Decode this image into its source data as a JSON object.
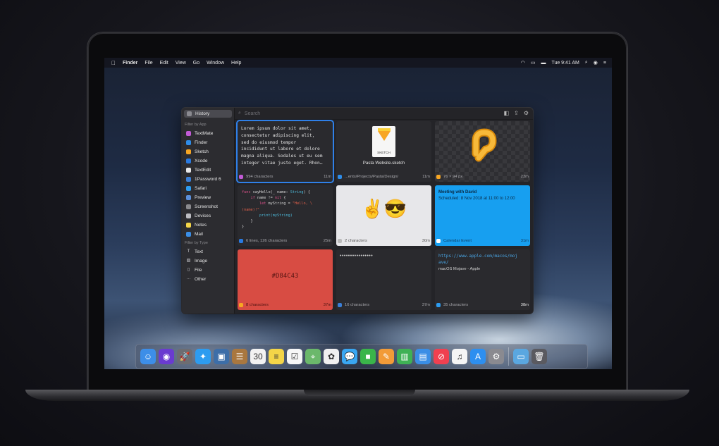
{
  "menubar": {
    "app": "Finder",
    "menus": [
      "File",
      "Edit",
      "View",
      "Go",
      "Window",
      "Help"
    ],
    "clock": "Tue 9:41 AM"
  },
  "sidebar": {
    "history": "History",
    "filter_by_app_label": "Filter by App",
    "apps": [
      {
        "label": "TextMate",
        "icon": "textmate-icon",
        "color": "#c25bd6"
      },
      {
        "label": "Finder",
        "icon": "finder-icon",
        "color": "#2e8ce8"
      },
      {
        "label": "Sketch",
        "icon": "sketch-icon",
        "color": "#f7a623"
      },
      {
        "label": "Xcode",
        "icon": "xcode-icon",
        "color": "#2a7ae0"
      },
      {
        "label": "TextEdit",
        "icon": "textedit-icon",
        "color": "#e8e8e8"
      },
      {
        "label": "1Password 6",
        "icon": "onepassword-icon",
        "color": "#3b7fd6"
      },
      {
        "label": "Safari",
        "icon": "safari-icon",
        "color": "#2d9cf0"
      },
      {
        "label": "Preview",
        "icon": "preview-icon",
        "color": "#5b8fd9"
      },
      {
        "label": "Screenshot",
        "icon": "screenshot-icon",
        "color": "#8a8a8e"
      },
      {
        "label": "Devices",
        "icon": "devices-icon",
        "color": "#bdbdc2"
      },
      {
        "label": "Notes",
        "icon": "notes-icon",
        "color": "#f4d548"
      },
      {
        "label": "Mail",
        "icon": "mail-icon",
        "color": "#3a8ee6"
      }
    ],
    "filter_by_type_label": "Filter by Type",
    "types": [
      {
        "label": "Text",
        "icon": "text-type-icon"
      },
      {
        "label": "Image",
        "icon": "image-type-icon"
      },
      {
        "label": "File",
        "icon": "file-type-icon"
      },
      {
        "label": "Other",
        "icon": "other-type-icon"
      }
    ]
  },
  "search": {
    "placeholder": "Search"
  },
  "cards": {
    "lorem": {
      "text": "Lorem ipsum dolor sit amet,\nconsectetur adipiscing elit,\nsed do eiusmod tempor\nincididunt ut labore et dolore\nmagna aliqua. Sodales ut eu sem\ninteger vitae justo eget. Rhon…",
      "meta": "994 characters",
      "time": "11m"
    },
    "sketch": {
      "file_label": "SKETCH",
      "filename": "Pasta Website.sketch",
      "meta": "...ents/Projects/Pasta/Design/",
      "time": "11m"
    },
    "image": {
      "meta": "76 × 94 px",
      "time": "23m"
    },
    "code": {
      "l1a": "func",
      "l1b": " sayHello(_ name: ",
      "l1c": "String",
      "l1d": ") {",
      "l2a": "    if",
      "l2b": " name != ",
      "l2c": "nil",
      "l2d": " {",
      "l3a": "        let",
      "l3b": " myString = ",
      "l3c": "\"Hello, \\",
      "l4a": "(name)!\"",
      "l5": "        print(myString)",
      "l6": "    }",
      "l7": "}",
      "meta": "6 lines, 126 characters",
      "time": "25m"
    },
    "emoji": {
      "text": "✌️😎",
      "meta": "2 characters",
      "time": "30m"
    },
    "calendar": {
      "title": "Meeting with David",
      "scheduled": "Scheduled: 8 Nov 2018 at 11:00 to 12:00",
      "meta": "Calendar Event",
      "time": "31m"
    },
    "color": {
      "value": "#D84C43",
      "meta": "8 characters",
      "time": "37m"
    },
    "password": {
      "dots": "••••••••••••••••",
      "meta": "16 characters",
      "time": "37m"
    },
    "link": {
      "url": "https://www.apple.com/macos/moj\nave/",
      "title": "macOS Mojave - Apple",
      "meta": "35 characters",
      "time": "38m"
    }
  },
  "dock": {
    "apps": [
      {
        "name": "finder-dock-icon",
        "glyph": "☺",
        "color": "#3d8ee8"
      },
      {
        "name": "siri-dock-icon",
        "glyph": "◉",
        "color": "#6a3bd0"
      },
      {
        "name": "launchpad-dock-icon",
        "glyph": "🚀",
        "color": "#6d6d72"
      },
      {
        "name": "safari-dock-icon",
        "glyph": "✦",
        "color": "#2d9cf0"
      },
      {
        "name": "photo-booth-dock-icon",
        "glyph": "▣",
        "color": "#3d6ea8"
      },
      {
        "name": "contacts-dock-icon",
        "glyph": "☰",
        "color": "#a9773f"
      },
      {
        "name": "calendar-dock-icon",
        "glyph": "30",
        "color": "#f2f2f2"
      },
      {
        "name": "notes-dock-icon",
        "glyph": "≡",
        "color": "#f4d548"
      },
      {
        "name": "reminders-dock-icon",
        "glyph": "☑",
        "color": "#f7f7f7"
      },
      {
        "name": "maps-dock-icon",
        "glyph": "⌖",
        "color": "#6bb86b"
      },
      {
        "name": "photos-dock-icon",
        "glyph": "✿",
        "color": "#f0f0f0"
      },
      {
        "name": "messages-dock-icon",
        "glyph": "💬",
        "color": "#3aa7f2"
      },
      {
        "name": "facetime-dock-icon",
        "glyph": "■",
        "color": "#3ab54a"
      },
      {
        "name": "pages-dock-icon",
        "glyph": "✎",
        "color": "#f29b38"
      },
      {
        "name": "numbers-dock-icon",
        "glyph": "▥",
        "color": "#3fb155"
      },
      {
        "name": "keynote-dock-icon",
        "glyph": "▤",
        "color": "#3a8ee6"
      },
      {
        "name": "news-dock-icon",
        "glyph": "⊘",
        "color": "#f04050"
      },
      {
        "name": "music-dock-icon",
        "glyph": "♫",
        "color": "#f5f5f5"
      },
      {
        "name": "app-store-dock-icon",
        "glyph": "A",
        "color": "#2d8ff0"
      },
      {
        "name": "system-preferences-dock-icon",
        "glyph": "⚙",
        "color": "#8a8a90"
      }
    ],
    "extras": [
      {
        "name": "downloads-folder-dock-icon",
        "glyph": "▭",
        "color": "#5aa7e0"
      },
      {
        "name": "trash-dock-icon",
        "glyph": "🗑",
        "color": "#5a5a60"
      }
    ]
  }
}
